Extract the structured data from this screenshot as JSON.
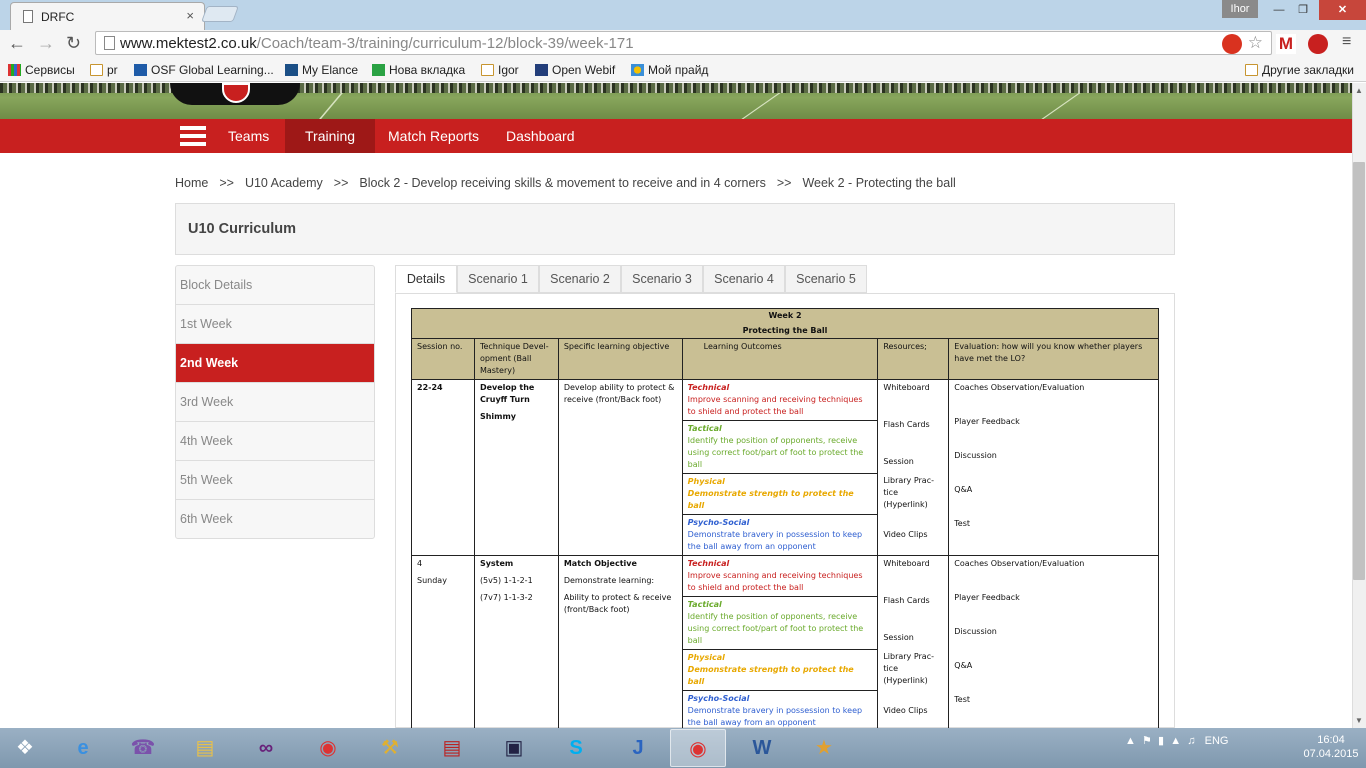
{
  "browser": {
    "tab_title": "DRFC",
    "tab_close": "×",
    "user": "Ihor",
    "url_host": "www.mektest2.co.uk",
    "url_path": "/Coach/team-3/training/curriculum-12/block-39/week-171",
    "bookmarks": [
      "Сервисы",
      "pr",
      "OSF Global Learning...",
      "My Elance",
      "Нова вкладка",
      "Igor",
      "Open Webif",
      "Мой прайд"
    ],
    "other_bookmarks": "Другие закладки",
    "ext_gmail_label": "M"
  },
  "nav": {
    "items": [
      "Teams",
      "Training",
      "Match Reports",
      "Dashboard"
    ],
    "active": "Training"
  },
  "breadcrumb": {
    "sep": ">>",
    "items": [
      "Home",
      "U10 Academy",
      "Block 2 - Develop receiving skills & movement to receive and in 4 corners",
      "Week 2 - Protecting the ball"
    ]
  },
  "page_title": "U10 Curriculum",
  "sidebar": {
    "items": [
      "Block Details",
      "1st Week",
      "2nd Week",
      "3rd Week",
      "4th Week",
      "5th Week",
      "6th Week"
    ],
    "active": "2nd Week"
  },
  "tabs": {
    "items": [
      "Details",
      "Scenario 1",
      "Scenario 2",
      "Scenario 3",
      "Scenario 4",
      "Scenario 5"
    ],
    "active": "Details"
  },
  "plan": {
    "title": "Week 2",
    "subtitle": "Protecting the Ball",
    "headers": [
      "Session no.",
      "Technique Devel-opment (Ball Mastery)",
      "Specific learning objective",
      "Learning Outcomes",
      "Resources;",
      "Evaluation: how will you know whether players have met the LO?"
    ],
    "rows": [
      {
        "session": "22-24",
        "session2": "",
        "technique": "Develop the Cruyff Turn",
        "technique2": "Shimmy",
        "technique3": "",
        "objective_title": "",
        "objective": "Develop ability to protect & receive (front/Back foot)",
        "objective2": "",
        "outcomes": [
          {
            "k": "Technical",
            "t": "Improve scanning and receiving techniques to shield and protect the ball"
          },
          {
            "k": "Tactical",
            "t": "Identify the position of opponents, receive using correct foot/part of foot to protect the ball"
          },
          {
            "k": "Physical",
            "t": "Demonstrate strength to protect the ball"
          },
          {
            "k": "Psycho-Social",
            "t": "Demonstrate bravery in possession to keep the ball away from an opponent"
          }
        ],
        "resources": [
          "Whiteboard",
          "Flash Cards",
          "Session",
          "Library Prac-tice (Hyperlink)",
          "Video Clips"
        ],
        "evaluation": [
          "Coaches Observation/Evaluation",
          "Player Feedback",
          "Discussion",
          "Q&A",
          "Test"
        ]
      },
      {
        "session": "4",
        "session2": "Sunday",
        "technique": "System",
        "technique2": "(5v5) 1-1-2-1",
        "technique3": "(7v7) 1-1-3-2",
        "objective_title": "Match Objective",
        "objective": "Demonstrate learning:",
        "objective2": "Ability to protect & receive (front/Back foot)",
        "outcomes": [
          {
            "k": "Technical",
            "t": "Improve scanning and receiving techniques to shield and protect the ball"
          },
          {
            "k": "Tactical",
            "t": "Identify the position of opponents, receive using correct foot/part of foot to protect the ball"
          },
          {
            "k": "Physical",
            "t": "Demonstrate strength to protect the ball"
          },
          {
            "k": "Psycho-Social",
            "t": "Demonstrate bravery in possession to keep the ball away from an opponent"
          }
        ],
        "resources": [
          "Whiteboard",
          "Flash Cards",
          "Session",
          "Library Prac-tice (Hyperlink)",
          "Video Clips"
        ],
        "evaluation": [
          "Coaches Observation/Evaluation",
          "Player Feedback",
          "Discussion",
          "Q&A",
          "Test"
        ]
      }
    ]
  },
  "taskbar": {
    "lang": "ENG",
    "time": "16:04",
    "date": "07.04.2015"
  }
}
